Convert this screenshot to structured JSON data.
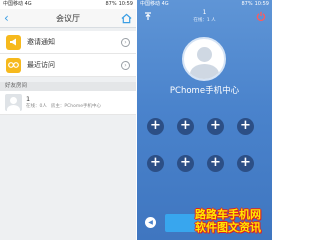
{
  "left": {
    "status_bar": {
      "carrier": "中国移动 4G",
      "battery": "87%",
      "time": "10:59"
    },
    "header": {
      "title": "会议厅"
    },
    "menu": [
      {
        "label": "邀请通知",
        "icon": "megaphone-icon"
      },
      {
        "label": "最近访问",
        "icon": "eye-icon"
      }
    ],
    "section_title": "好友房间",
    "room": {
      "name": "1",
      "online": "在线：0人",
      "host": "房主：PChome手机中心"
    }
  },
  "right": {
    "status_bar": {
      "carrier": "中国移动 4G",
      "battery": "87%",
      "time": "10:59"
    },
    "room_title": "1",
    "room_online": "在线：1 人",
    "user_name": "PChome手机中心",
    "seats": [
      "+",
      "+",
      "+",
      "+",
      "+",
      "+",
      "+",
      "+"
    ],
    "watermark": [
      "路路车手机网",
      "软件图文资讯"
    ]
  },
  "colors": {
    "accent": "#3a9ee4",
    "menu_icon": "#f6b91d",
    "room_bg": "#4a83cc",
    "seat": "#2c4f86",
    "watermark": "#ffe600"
  }
}
